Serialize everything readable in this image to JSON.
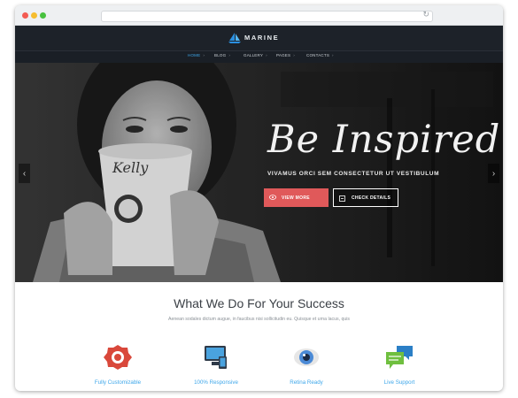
{
  "brand": {
    "name": "MARINE"
  },
  "nav": {
    "items": [
      {
        "label": "HOME",
        "active": true
      },
      {
        "label": "BLOG"
      },
      {
        "label": "GALLERY"
      },
      {
        "label": "PAGES"
      },
      {
        "label": "CONTACTS"
      }
    ],
    "chevron": "›"
  },
  "hero": {
    "cup_text": "Kelly",
    "headline": "Be Inspired",
    "subhead": "VIVAMUS ORCI SEM CONSECTETUR UT VESTIBULUM",
    "primary_button": "VIEW MORE",
    "secondary_button": "CHECK DETAILS",
    "prev_arrow": "‹",
    "next_arrow": "›"
  },
  "section": {
    "title": "What We Do For Your Success",
    "text": "Aenean sodales dictum augue, in faucibus nisi sollicitudin eu. Quisque et urna lacus, quis"
  },
  "features": [
    {
      "label": "Fully Customizable",
      "icon": "gear-icon"
    },
    {
      "label": "100% Responsive",
      "icon": "devices-icon"
    },
    {
      "label": "Retina Ready",
      "icon": "eye-icon"
    },
    {
      "label": "Live Support",
      "icon": "chat-icon"
    }
  ],
  "colors": {
    "accent": "#3ea7ea",
    "button": "#e0595a",
    "header_bg": "#1d2229"
  }
}
